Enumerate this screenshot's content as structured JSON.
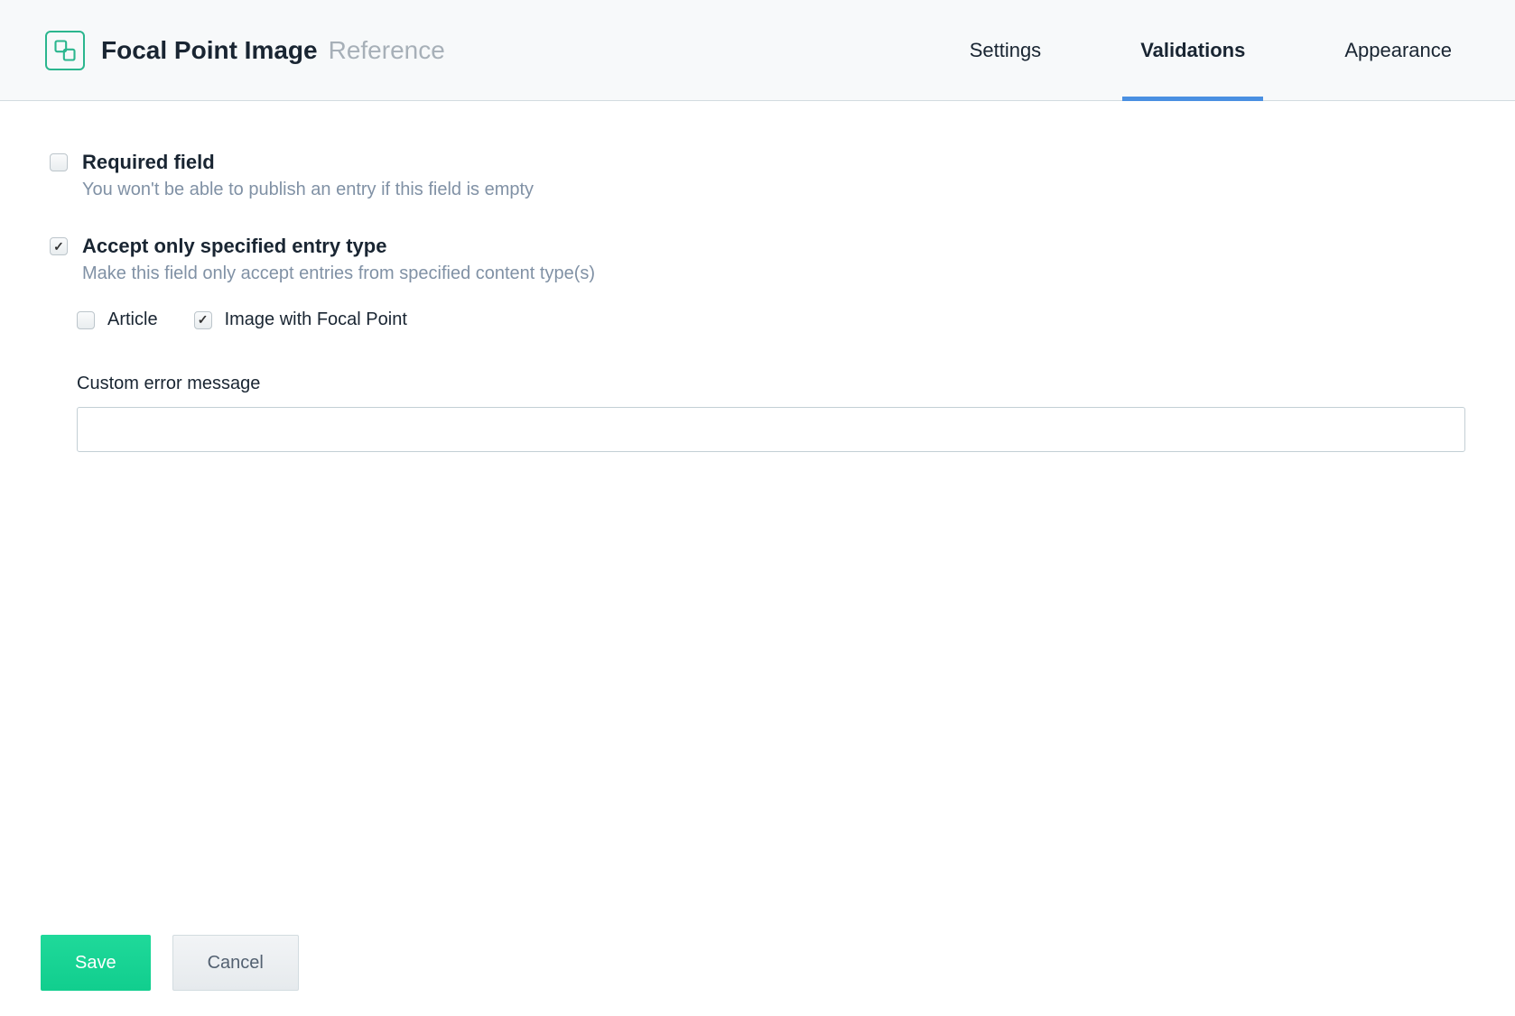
{
  "header": {
    "field_title": "Focal Point Image",
    "field_type": "Reference"
  },
  "tabs": [
    {
      "label": "Settings",
      "active": false
    },
    {
      "label": "Validations",
      "active": true
    },
    {
      "label": "Appearance",
      "active": false
    }
  ],
  "validations": {
    "required": {
      "label": "Required field",
      "description": "You won't be able to publish an entry if this field is empty",
      "checked": false
    },
    "accept_type": {
      "label": "Accept only specified entry type",
      "description": "Make this field only accept entries from specified content type(s)",
      "checked": true,
      "types": [
        {
          "label": "Article",
          "checked": false
        },
        {
          "label": "Image with Focal Point",
          "checked": true
        }
      ]
    },
    "custom_error": {
      "label": "Custom error message",
      "value": ""
    }
  },
  "footer": {
    "save_label": "Save",
    "cancel_label": "Cancel"
  }
}
